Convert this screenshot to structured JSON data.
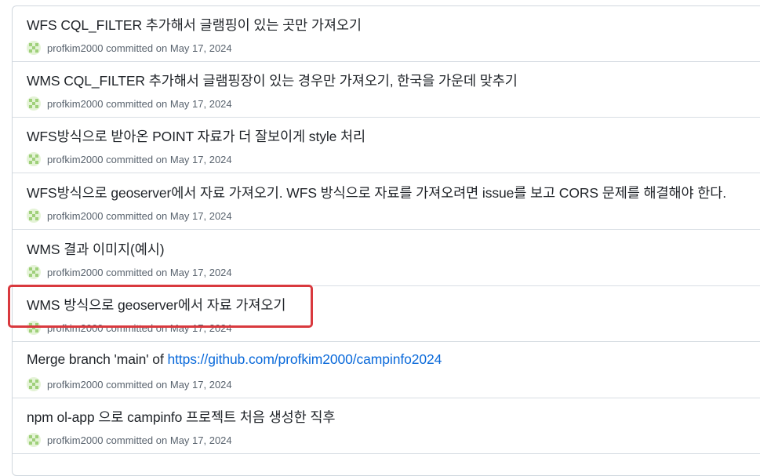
{
  "commits": [
    {
      "title": "WFS CQL_FILTER 추가해서 글램핑이 있는 곳만 가져오기",
      "author": "profkim2000",
      "action": "committed",
      "date_prefix": "on",
      "date": "May 17, 2024"
    },
    {
      "title": "WMS CQL_FILTER 추가해서 글램핑장이 있는 경우만 가져오기, 한국을 가운데 맞추기",
      "author": "profkim2000",
      "action": "committed",
      "date_prefix": "on",
      "date": "May 17, 2024"
    },
    {
      "title": "WFS방식으로 받아온 POINT 자료가 더 잘보이게 style 처리",
      "author": "profkim2000",
      "action": "committed",
      "date_prefix": "on",
      "date": "May 17, 2024"
    },
    {
      "title": "WFS방식으로 geoserver에서 자료 가져오기. WFS 방식으로 자료를 가져오려면 issue를 보고 CORS 문제를 해결해야 한다.",
      "author": "profkim2000",
      "action": "committed",
      "date_prefix": "on",
      "date": "May 17, 2024"
    },
    {
      "title": "WMS 결과 이미지(예시)",
      "author": "profkim2000",
      "action": "committed",
      "date_prefix": "on",
      "date": "May 17, 2024"
    },
    {
      "title": "WMS 방식으로 geoserver에서 자료 가져오기",
      "author": "profkim2000",
      "action": "committed",
      "date_prefix": "on",
      "date": "May 17, 2024"
    },
    {
      "title_prefix": "Merge branch 'main' of ",
      "title_link": "https://github.com/profkim2000/campinfo2024",
      "author": "profkim2000",
      "action": "committed",
      "date_prefix": "on",
      "date": "May 17, 2024"
    },
    {
      "title": "npm ol-app 으로 campinfo 프로젝트 처음 생성한 직후",
      "author": "profkim2000",
      "action": "committed",
      "date_prefix": "on",
      "date": "May 17, 2024"
    }
  ],
  "colors": {
    "title": "#1f2328",
    "meta": "#59636e",
    "link": "#0969da",
    "highlight": "#d9393e",
    "avatar_light": "#e4f3d6",
    "avatar_dark": "#9fd07a"
  },
  "icons": {
    "avatar": "identicon-avatar"
  },
  "annotation": {
    "highlighted_row_index": 5
  }
}
